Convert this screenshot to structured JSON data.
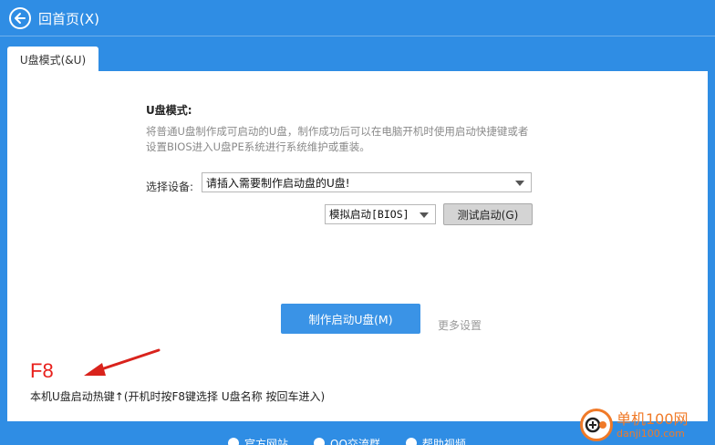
{
  "header": {
    "back_label": "回首页(X)"
  },
  "tabs": [
    {
      "label": "U盘模式(&U)"
    }
  ],
  "usb_mode": {
    "title": "U盘模式:",
    "description": "将普通U盘制作成可启动的U盘，制作成功后可以在电脑开机时使用启动快捷键或者设置BIOS进入U盘PE系统进行系统维护或重装。",
    "select_label": "选择设备:",
    "device_value": "请插入需要制作启动盘的U盘!",
    "boot_value": "模拟启动[BIOS]",
    "test_button": "测试启动(G)",
    "make_button": "制作启动U盘(M)",
    "more_settings": "更多设置"
  },
  "hotkey": {
    "value": "F8",
    "description": "本机U盘启动热键↑(开机时按F8键选择 U盘名称 按回车进入)"
  },
  "footer": {
    "items": [
      {
        "label": "官方网站"
      },
      {
        "label": "QQ交流群"
      },
      {
        "label": "帮助视频"
      }
    ]
  },
  "watermark": {
    "title": "单机100网",
    "url": "danji100.com"
  },
  "colors": {
    "background": "#2f8de4",
    "primary_button": "#3a93e6",
    "hotkey": "#e8201c",
    "watermark": "#f07a28"
  }
}
